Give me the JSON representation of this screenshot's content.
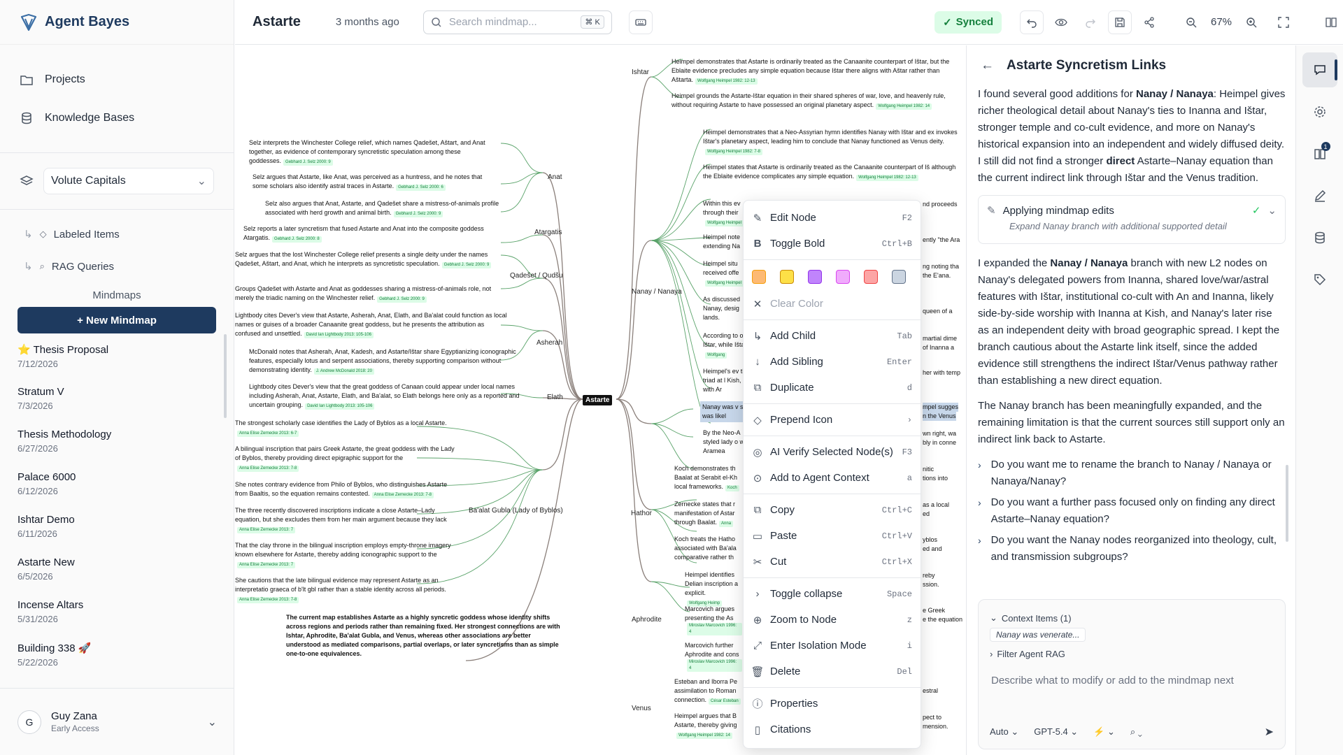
{
  "brand": {
    "name": "Agent Bayes"
  },
  "sidebar": {
    "nav": [
      {
        "label": "Projects",
        "icon": "folder-icon"
      },
      {
        "label": "Knowledge Bases",
        "icon": "database-icon"
      }
    ],
    "workspace": "Volute Capitals",
    "sub": [
      {
        "label": "Labeled Items"
      },
      {
        "label": "RAG Queries"
      }
    ],
    "mindmaps_heading": "Mindmaps",
    "new_mindmap": "+ New Mindmap",
    "mindmaps": [
      {
        "title": "⭐ Thesis Proposal",
        "date": "7/12/2026"
      },
      {
        "title": "Stratum V",
        "date": "7/3/2026"
      },
      {
        "title": "Thesis Methodology",
        "date": "6/27/2026"
      },
      {
        "title": "Palace 6000",
        "date": "6/12/2026"
      },
      {
        "title": "Ishtar Demo",
        "date": "6/11/2026"
      },
      {
        "title": "Astarte New",
        "date": "6/5/2026"
      },
      {
        "title": "Incense Altars",
        "date": "5/31/2026"
      },
      {
        "title": "Building 338 🚀",
        "date": "5/22/2026"
      }
    ],
    "user": {
      "initial": "G",
      "name": "Guy Zana",
      "status": "Early Access"
    }
  },
  "topbar": {
    "title": "Astarte",
    "updated": "3 months ago",
    "search_placeholder": "Search mindmap...",
    "search_kbd": "⌘ K",
    "synced": "Synced",
    "zoom": "67%"
  },
  "map": {
    "root": "Astarte",
    "branches": [
      "Ishtar",
      "Anat",
      "Atargatis",
      "Qadešet / Qudšu",
      "Asherah",
      "Elath",
      "Ba'alat Gubla (Lady of Byblos)",
      "Nanay / Nanaya",
      "Hathor",
      "Aphrodite",
      "Venus"
    ],
    "left_nodes": [
      {
        "text": "Selz interprets the Winchester College relief, which names Qadešet, Aštart, and Anat together, as evidence of contemporary syncretistic speculation among these goddesses.",
        "cite": "Gebhard J. Selz 2000: 9"
      },
      {
        "text": "Selz argues that Astarte, like Anat, was perceived as a huntress, and he notes that some scholars also identify astral traces in Astarte.",
        "cite": "Gebhard J. Selz 2000: 6"
      },
      {
        "text": "Selz also argues that Anat, Astarte, and Qadešet share a mistress-of-animals profile associated with herd growth and animal birth.",
        "cite": "Gebhard J. Selz 2000: 9"
      },
      {
        "text": "Selz reports a later syncretism that fused Astarte and Anat into the composite goddess Atargatis.",
        "cite": "Gebhard J. Selz 2000: 8"
      },
      {
        "text": "Selz argues that the lost Winchester College relief presents a single deity under the names Qadešet, Aštart, and Anat, which he interprets as syncretistic speculation.",
        "cite": "Gebhard J. Selz 2000: 9"
      },
      {
        "text": "Groups Qadešet with Astarte and Anat as goddesses sharing a mistress-of-animals role, not merely the triadic naming on the Winchester relief.",
        "cite": "Gebhard J. Selz 2000: 9"
      },
      {
        "text": "Lightbody cites Dever's view that Astarte, Asherah, Anat, Elath, and Ba'alat could function as local names or guises of a broader Canaanite great goddess, but he presents the attribution as confused and unsettled.",
        "cite": "David Ian Lightbody 2013: 105-106"
      },
      {
        "text": "McDonald notes that Asherah, Anat, Kadesh, and Astarte/Ištar share Egyptianizing iconographic features, especially lotus and serpent associations, thereby supporting comparison without demonstrating identity.",
        "cite": "J. Andrew McDonald 2018: 20"
      },
      {
        "text": "Lightbody cites Dever's view that the great goddess of Canaan could appear under local names including Asherah, Anat, Astarte, Elath, and Ba'alat, so Elath belongs here only as a reported and uncertain grouping.",
        "cite": "David Ian Lightbody 2013: 105-106"
      },
      {
        "text": "The strongest scholarly case identifies the Lady of Byblos as a local Astarte.",
        "cite": "Anna Elise Zernecke 2013: 6-7"
      },
      {
        "text": "A bilingual inscription that pairs Greek Astarte, the great goddess with the Lady of Byblos, thereby providing direct epigraphic support for the",
        "cite": "Anna Elise Zernecke 2013: 7-8"
      },
      {
        "text": "She notes contrary evidence from Philo of Byblos, who distinguishes Astarte from Baaltis, so the equation remains contested.",
        "cite": "Anna Elise Zernecke 2013: 7-8"
      },
      {
        "text": "The three recently discovered inscriptions indicate a close Astarte–Lady equation, but she excludes them from her main argument because they lack",
        "cite": "Anna Elise Zernecke 2013: 7"
      },
      {
        "text": "That the clay throne in the bilingual inscription employs empty-throne imagery known elsewhere for Astarte, thereby adding iconographic support to the",
        "cite": "Anna Elise Zernecke 2013: 7"
      },
      {
        "text": "She cautions that the late bilingual evidence may represent Astarte as an interpretatio graeca of b'lt gbl rather than a stable identity across all periods.",
        "cite": "Anna Elise Zernecke 2013: 7-8"
      }
    ],
    "summary": "The current map establishes Astarte as a highly syncretic goddess whose identity shifts across regions and periods rather than remaining fixed. Her strongest connections are with Ishtar, Aphrodite, Ba'alat Gubla, and Venus, whereas other associations are better understood as mediated comparisons, partial overlaps, or later syncretisms than as simple one-to-one equivalences.",
    "right_nodes": [
      {
        "text": "Heimpel demonstrates that Astarte is ordinarily treated as the Canaanite counterpart of Ištar, but the Eblaite evidence precludes any simple equation because Ištar there aligns with Aštar rather than Aštarta.",
        "cite": "Wolfgang Heimpel 1982: 12-13"
      },
      {
        "text": "Heimpel grounds the Astarte-Ištar equation in their shared spheres of war, love, and heavenly rule, without requiring Astarte to have possessed an original planetary aspect.",
        "cite": "Wolfgang Heimpel 1982: 14"
      },
      {
        "text": "Heimpel demonstrates that a Neo-Assyrian hymn identifies Nanay with Ištar and ex invokes Ištar's planetary aspect, leading him to conclude that Nanay functioned as Venus deity.",
        "cite": "Wolfgang Heimpel 1982: 7-8"
      },
      {
        "text": "Heimpel states that Astarte is ordinarily treated as the Canaanite counterpart of Iš although the Eblaite evidence complicates any simple equation.",
        "cite": "Wolfgang Heimpel 1982: 12-13"
      },
      {
        "text": "Within this ev through their",
        "cite": "Wolfgang Heimpel"
      },
      {
        "text": "Heimpel note extending Na",
        "cite": ""
      },
      {
        "text": "Heimpel situ received offe",
        "cite": "Wolfgang Heimpel"
      },
      {
        "text": "As discussed Nanay, desig lands.",
        "cite": ""
      },
      {
        "text": "According to of Ištar, while Ištar.",
        "cite": "Wolfgang"
      },
      {
        "text": "Heimpel's ev that triad at l Kish, with Ar",
        "cite": ""
      },
      {
        "text": "Nanay was v she was likel",
        "cite": ""
      },
      {
        "text": "By the Neo-A styled lady o with Aramea",
        "cite": ""
      },
      {
        "text": "Koch demonstrates th Baalat at Serabit el-Kh local frameworks.",
        "cite": "Koch"
      },
      {
        "text": "Zernecke states that r manifestation of Astar through Baalat.",
        "cite": "Anna"
      },
      {
        "text": "Koch treats the Hatho associated with Ba'ala comparative rather th",
        "cite": ""
      },
      {
        "text": "Heimpel identifies Delian inscription a explicit.",
        "cite": "Wolfgang Heimp"
      },
      {
        "text": "Marcovich argues presenting the As",
        "cite": "Miroslav Marcovich 1996: 4"
      },
      {
        "text": "Marcovich further Aphrodite and cons",
        "cite": "Miroslav Marcovich 1996: 4"
      },
      {
        "text": "Esteban and Iborra Pe assimilation to Roman connection.",
        "cite": "César Esteban"
      },
      {
        "text": "Heimpel argues that B Astarte, thereby giving",
        "cite": "Wolfgang Heimpel 1982: 14"
      }
    ],
    "right_edge_fragments": [
      "nd proceeds",
      "ently \"the Ara",
      "ng noting tha",
      "the E'ana.",
      "queen of a",
      "martial dime",
      "of Inanna a",
      "her with temp",
      "mpel sugges",
      "n the Venus",
      "wn right, wa",
      "bly in conne",
      "nitic",
      "tions into",
      "as a local",
      "ed",
      "yblos",
      "ed and",
      "reby",
      "ssion.",
      "e Greek",
      "e the equation",
      "estral",
      "pect to",
      "mension."
    ]
  },
  "context_menu": {
    "items": [
      {
        "label": "Edit Node",
        "shortcut": "F2",
        "icon": "pencil-icon"
      },
      {
        "label": "Toggle Bold",
        "shortcut": "Ctrl+B",
        "icon": "bold-icon"
      },
      {
        "label": "Clear Color",
        "shortcut": "",
        "icon": "x-icon",
        "disabled": true
      },
      {
        "label": "Add Child",
        "shortcut": "Tab",
        "icon": "child-arrow-icon"
      },
      {
        "label": "Add Sibling",
        "shortcut": "Enter",
        "icon": "down-arrow-icon"
      },
      {
        "label": "Duplicate",
        "shortcut": "d",
        "icon": "copy-icon"
      },
      {
        "label": "Prepend Icon",
        "shortcut": "›",
        "icon": "tag-icon"
      },
      {
        "label": "AI Verify Selected Node(s)",
        "shortcut": "F3",
        "icon": "check-circle-icon"
      },
      {
        "label": "Add to Agent Context",
        "shortcut": "a",
        "icon": "pin-icon"
      },
      {
        "label": "Copy",
        "shortcut": "Ctrl+C",
        "icon": "copy-icon"
      },
      {
        "label": "Paste",
        "shortcut": "Ctrl+V",
        "icon": "clipboard-icon"
      },
      {
        "label": "Cut",
        "shortcut": "Ctrl+X",
        "icon": "scissors-icon"
      },
      {
        "label": "Toggle collapse",
        "shortcut": "Space",
        "icon": "chevron-right-icon"
      },
      {
        "label": "Zoom to Node",
        "shortcut": "z",
        "icon": "zoom-icon"
      },
      {
        "label": "Enter Isolation Mode",
        "shortcut": "i",
        "icon": "expand-icon"
      },
      {
        "label": "Delete",
        "shortcut": "Del",
        "icon": "trash-icon"
      },
      {
        "label": "Properties",
        "shortcut": "",
        "icon": "info-icon"
      },
      {
        "label": "Citations",
        "shortcut": "",
        "icon": "book-icon"
      }
    ],
    "swatches": [
      "#fdba74",
      "#fde047",
      "#c084fc",
      "#f0abfc",
      "#fca5a5",
      "#cbd5e1"
    ]
  },
  "panel": {
    "title": "Astarte Syncretism Links",
    "para1_a": "I found several good additions for ",
    "para1_b": "Nanay / Nanaya",
    "para1_c": ": Heimpel gives richer theological detail about Nanay's ties to Inanna and Ištar, stronger temple and co-cult evidence, and more on Nanay's historical expansion into an independent and widely diffused deity. I still did not find a stronger ",
    "para1_d": "direct",
    "para1_e": " Astarte–Nanay equation than the current indirect link through Ištar and the Venus tradition.",
    "tool_title": "Applying mindmap edits",
    "tool_sub": "Expand Nanay branch with additional supported detail",
    "para2_a": "I expanded the ",
    "para2_b": "Nanay / Nanaya",
    "para2_c": " branch with new L2 nodes on Nanay's delegated powers from Inanna, shared love/war/astral features with Ištar, institutional co-cult with An and Inanna, likely side-by-side worship with Inanna at Kish, and Nanay's later rise as an independent deity with broad geographic spread. I kept the branch cautious about the Astarte link itself, since the added evidence still strengthens the indirect Ištar/Venus pathway rather than establishing a new direct equation.",
    "para3": "The Nanay branch has been meaningfully expanded, and the remaining limitation is that the current sources still support only an indirect link back to Astarte.",
    "questions": [
      "Do you want me to rename the branch to Nanay / Nanaya or Nanaya/Nanay?",
      "Do you want a further pass focused only on finding any direct Astarte–Nanay equation?",
      "Do you want the Nanay nodes reorganized into theology, cult, and transmission subgroups?"
    ],
    "context_label": "Context Items (1)",
    "context_chip": "Nanay was venerate...",
    "filter_label": "Filter Agent RAG",
    "placeholder": "Describe what to modify or add to the mindmap next",
    "mode": "Auto",
    "model": "GPT-5.4"
  },
  "rail": {
    "badge": "1"
  }
}
